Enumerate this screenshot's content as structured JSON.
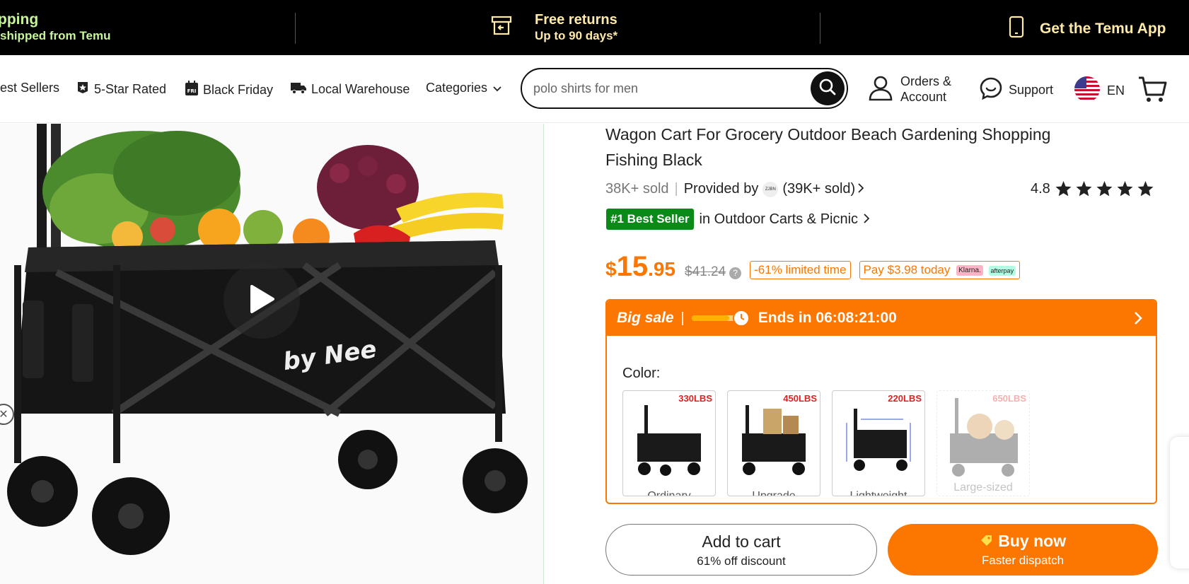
{
  "topbar": {
    "left_line1": "pping",
    "left_line2": "shipped from Temu",
    "returns_title": "Free returns",
    "returns_sub": "Up to 90 days*",
    "app_label": "Get the Temu App"
  },
  "nav": {
    "best_sellers": "est Sellers",
    "five_star": "5-Star Rated",
    "black_friday": "Black Friday",
    "local_warehouse": "Local Warehouse",
    "categories": "Categories",
    "search_placeholder": "polo shirts for men",
    "account_line1": "Orders &",
    "account_line2": "Account",
    "support": "Support",
    "language": "EN"
  },
  "product": {
    "title": "Wagon Cart For Grocery Outdoor Beach Gardening Shopping Fishing Black",
    "sold": "38K+ sold",
    "provided_by": "Provided by",
    "store_logo": "ZJBN",
    "store_sold": "(39K+ sold)",
    "rating": "4.8",
    "rating_stars": 5,
    "best_seller_badge": "#1 Best Seller",
    "best_seller_category": "in Outdoor Carts & Picnic",
    "price_currency": "$",
    "price_whole": "15",
    "price_cents": ".95",
    "original_price": "$41.24",
    "discount_tag": "-61% limited time",
    "pay_tag": "Pay $3.98 today",
    "klarna": "Klarna.",
    "afterpay": "afterpay"
  },
  "sale": {
    "label": "Big sale",
    "ends": "Ends in 06:08:21:00",
    "progress": 0.7
  },
  "colors": {
    "label": "Color:",
    "options": [
      {
        "capacity": "330LBS",
        "name": "Ordinary"
      },
      {
        "capacity": "450LBS",
        "name": "Upgrade"
      },
      {
        "capacity": "220LBS",
        "name": "Lightweight"
      },
      {
        "capacity": "650LBS",
        "name": "Large-sized"
      }
    ]
  },
  "gallery": {
    "brand": "by Nee"
  },
  "buttons": {
    "add_to_cart": "Add to cart",
    "add_to_cart_sub": "61% off discount",
    "buy_now": "Buy now",
    "buy_now_sub": "Faster dispatch"
  },
  "theme": {
    "accent": "#fb7701",
    "best_seller_green": "#0a8a17",
    "topbar_green": "#c9f59a",
    "topbar_yellow": "#ffe9a8"
  }
}
